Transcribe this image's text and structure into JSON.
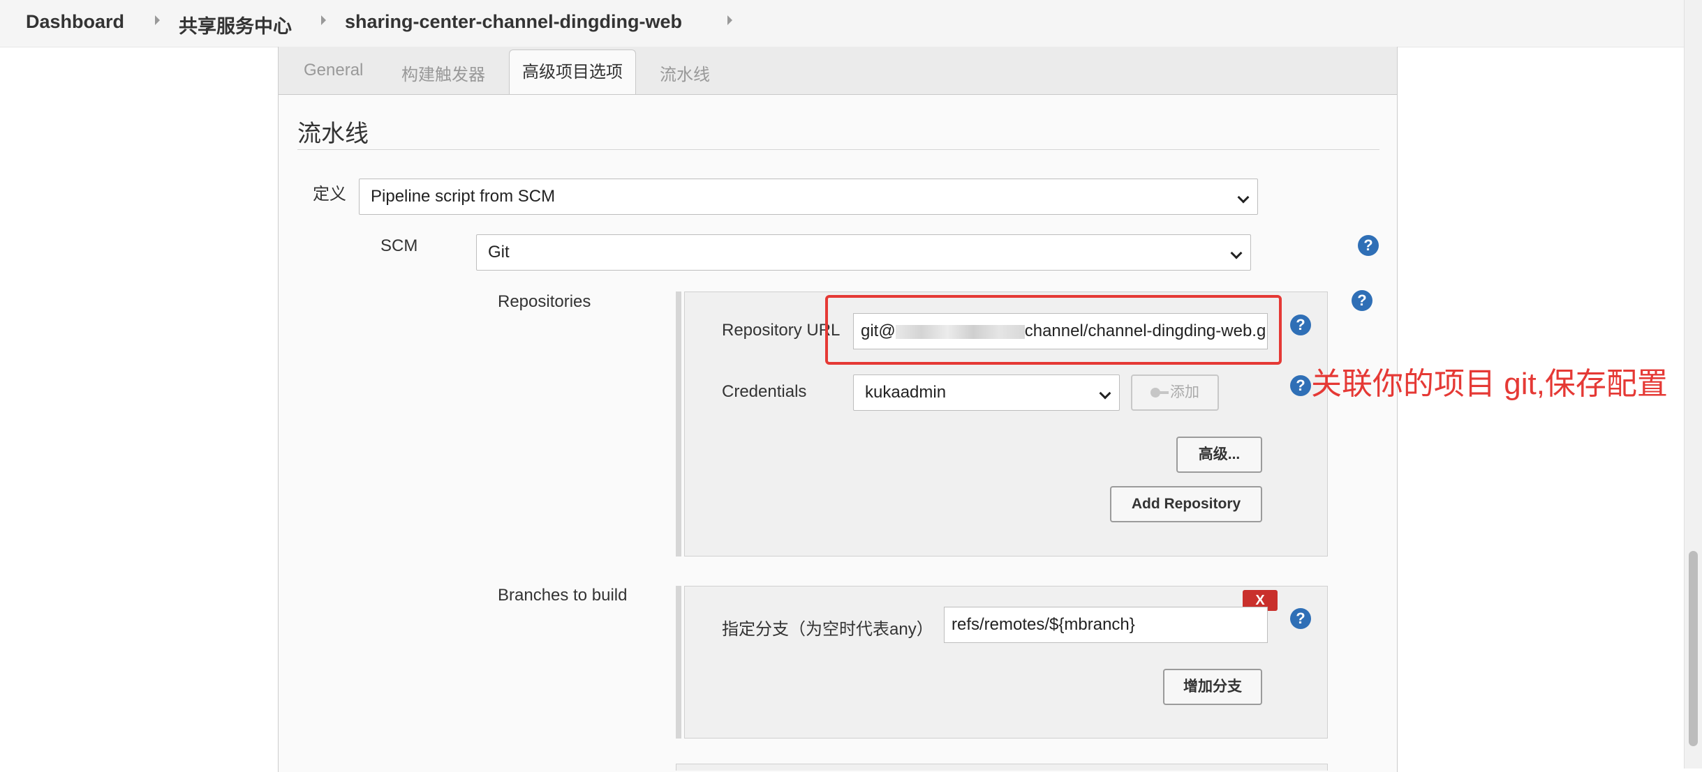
{
  "breadcrumb": {
    "items": [
      "Dashboard",
      "共享服务中心",
      "sharing-center-channel-dingding-web"
    ]
  },
  "tabs": [
    "General",
    "构建触发器",
    "高级项目选项",
    "流水线"
  ],
  "active_tab": "高级项目选项",
  "section": {
    "title": "流水线"
  },
  "definition": {
    "label": "定义",
    "value": "Pipeline script from SCM"
  },
  "scm": {
    "label": "SCM",
    "value": "Git"
  },
  "repositories": {
    "label": "Repositories",
    "url_label": "Repository URL",
    "url_prefix": "git@",
    "url_suffix": "channel/channel-dingding-web.g",
    "credentials_label": "Credentials",
    "credentials_value": "kukaadmin",
    "add_button": "添加",
    "advanced_button": "高级...",
    "add_repository_button": "Add Repository"
  },
  "branches": {
    "label": "Branches to build",
    "specifier_label": "指定分支（为空时代表any）",
    "specifier_value": "refs/remotes/${mbranch}",
    "delete_button": "X",
    "add_branch_button": "增加分支"
  },
  "help_symbol": "?",
  "annotation": {
    "text": "关联你的项目 git,保存配置",
    "color": "#e53935"
  },
  "colors": {
    "help": "#2f6fb6",
    "delete": "#c9302c",
    "annotation": "#e53935"
  }
}
